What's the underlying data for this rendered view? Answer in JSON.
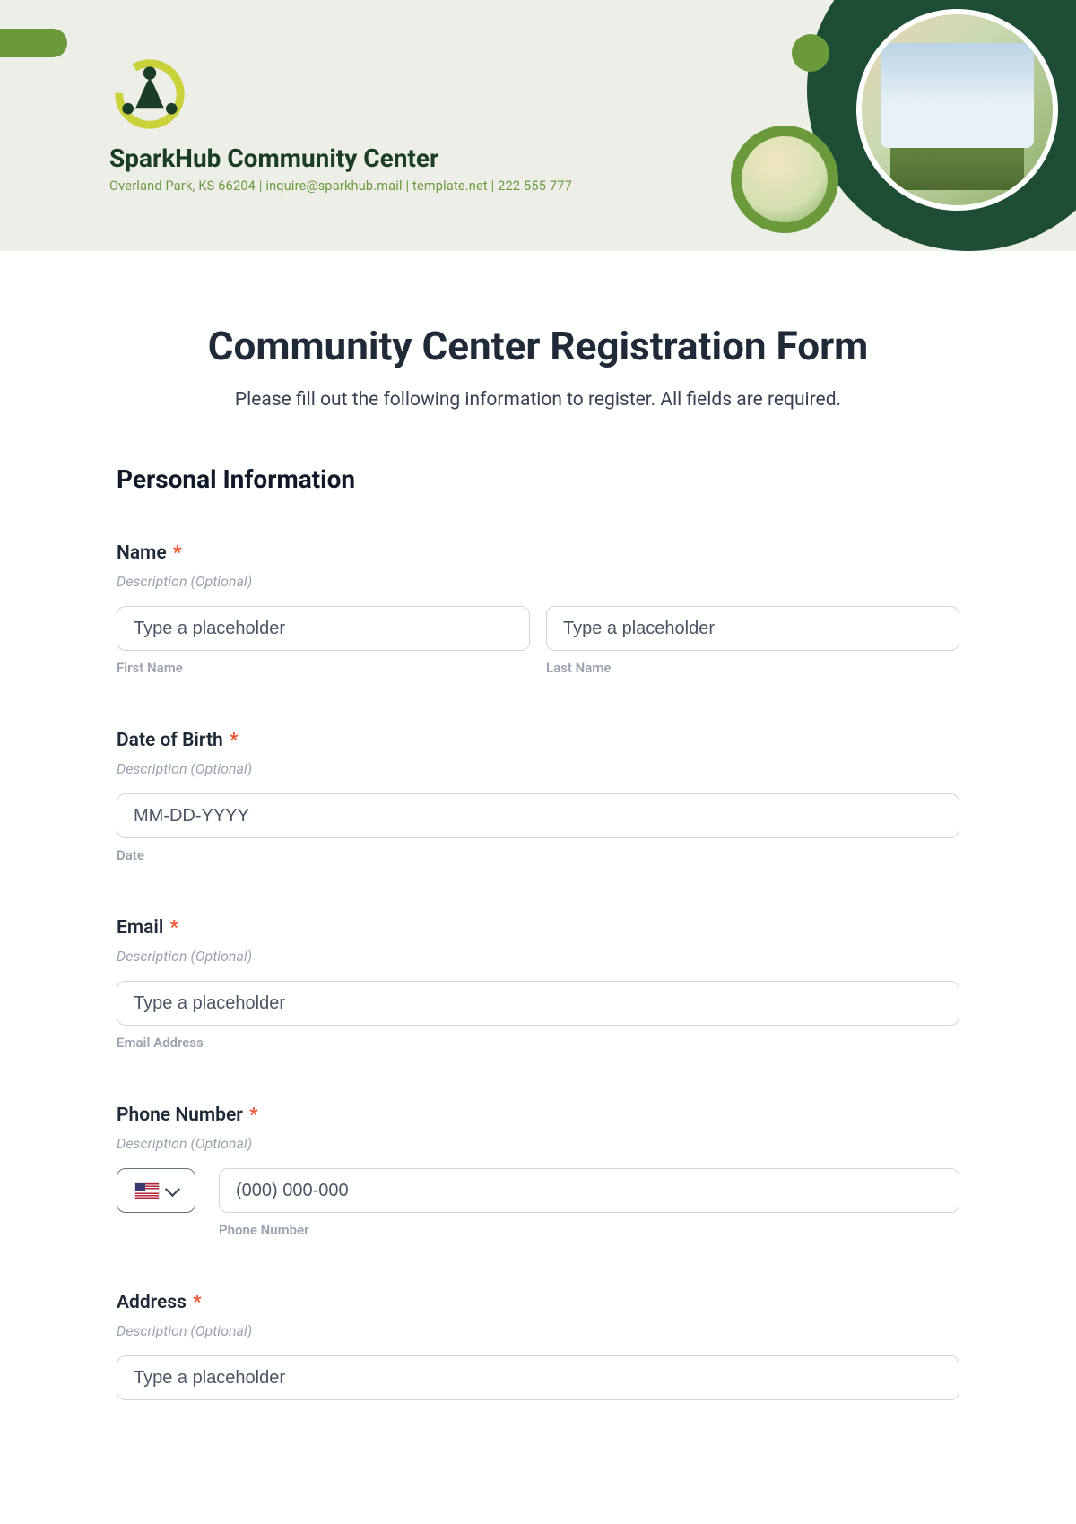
{
  "header": {
    "org_name": "SparkHub Community Center",
    "contact_line": "Overland Park, KS 66204 | inquire@sparkhub.mail | template.net | 222 555 777"
  },
  "form": {
    "title": "Community Center Registration Form",
    "subtitle": "Please fill out the following information to register. All fields are required.",
    "section_personal": "Personal Information",
    "required_marker": "*",
    "description_optional": "Description (Optional)",
    "placeholder_generic": "Type a placeholder",
    "name": {
      "label": "Name",
      "first_sub": "First Name",
      "last_sub": "Last Name"
    },
    "dob": {
      "label": "Date of Birth",
      "placeholder": "MM-DD-YYYY",
      "sub": "Date"
    },
    "email": {
      "label": "Email",
      "sub": "Email Address"
    },
    "phone": {
      "label": "Phone Number",
      "placeholder": "(000) 000-000",
      "sub": "Phone Number"
    },
    "address": {
      "label": "Address"
    }
  }
}
